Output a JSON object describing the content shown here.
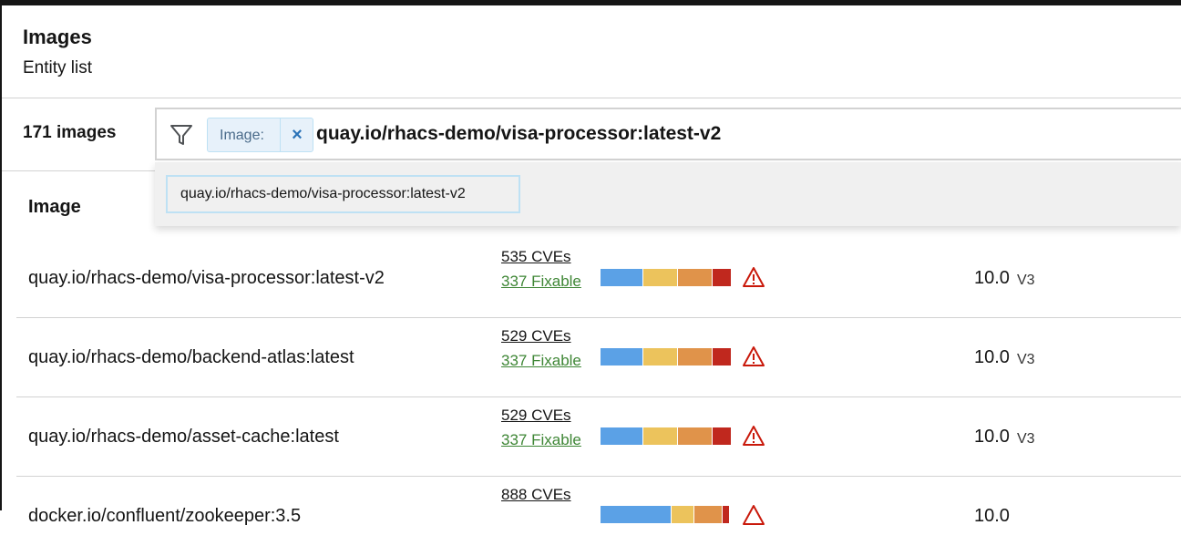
{
  "header": {
    "title": "Images",
    "subtitle": "Entity list"
  },
  "toolbar": {
    "count": "171 images",
    "chip_label": "Image:",
    "chip_close": "×",
    "search_value": "quay.io/rhacs-demo/visa-processor:latest-v2"
  },
  "dropdown": {
    "suggestion": "quay.io/rhacs-demo/visa-processor:latest-v2"
  },
  "table": {
    "column_image": "Image",
    "rows": [
      {
        "name": "quay.io/rhacs-demo/visa-processor:latest-v2",
        "cves": "535 CVEs",
        "fixable": "337 Fixable",
        "score": "10.0",
        "version": "V3"
      },
      {
        "name": "quay.io/rhacs-demo/backend-atlas:latest",
        "cves": "529 CVEs",
        "fixable": "337 Fixable",
        "score": "10.0",
        "version": "V3"
      },
      {
        "name": "quay.io/rhacs-demo/asset-cache:latest",
        "cves": "529 CVEs",
        "fixable": "337 Fixable",
        "score": "10.0",
        "version": "V3"
      },
      {
        "name": "docker.io/confluent/zookeeper:3.5",
        "cves": "888 CVEs",
        "fixable": "",
        "score": "10.0",
        "version": ""
      }
    ]
  },
  "colors": {
    "low": "#5ba1e6",
    "moderate": "#ecc35c",
    "important": "#e0934a",
    "critical": "#c0281e",
    "fixable": "#3e8635",
    "warning": "#c9190b"
  }
}
